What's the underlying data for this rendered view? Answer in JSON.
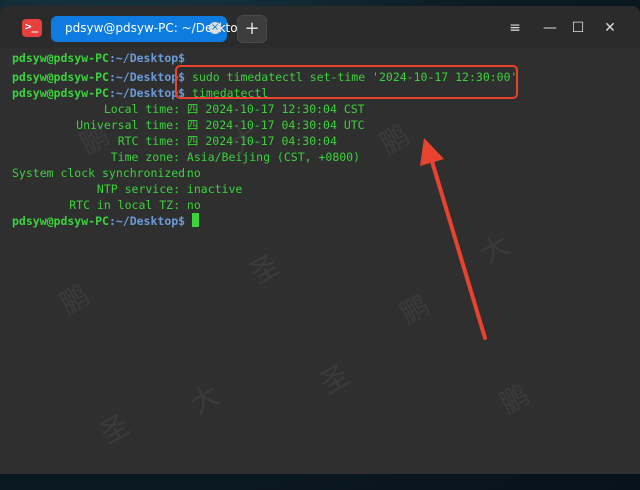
{
  "window": {
    "tab_title": "pdsyw@pdsyw-PC: ~/Desktop",
    "new_tab": "+",
    "tab_close": "×",
    "minimize": "—",
    "maximize": "☐",
    "close": "✕",
    "menu": "≡"
  },
  "terminal": {
    "prompt_user": "pdsyw@pdsyw-PC",
    "prompt_path": ":~/Desktop$",
    "lines": [
      {
        "cmd": ""
      },
      {
        "cmd": " sudo timedatectl set-time '2024-10-17 12:30:00'"
      },
      {
        "cmd": " timedatectl"
      }
    ],
    "output": [
      {
        "label": "Local time:",
        "value": " 四 2024-10-17 12:30:04 CST"
      },
      {
        "label": "Universal time:",
        "value": " 四 2024-10-17 04:30:04 UTC"
      },
      {
        "label": "RTC time:",
        "value": " 四 2024-10-17 04:30:04"
      },
      {
        "label": "Time zone:",
        "value": " Asia/Beijing (CST, +0800)"
      },
      {
        "label": "System clock synchronized:",
        "value": " no"
      },
      {
        "label": "NTP service:",
        "value": " inactive"
      },
      {
        "label": "RTC in local TZ:",
        "value": " no"
      }
    ]
  },
  "watermark": {
    "chars": [
      "鹏",
      "大",
      "圣"
    ]
  },
  "colors": {
    "accent": "#0d7be0",
    "terminal_text": "#3bd23b",
    "path": "#6a9bd8",
    "annotation": "#e8432e"
  }
}
